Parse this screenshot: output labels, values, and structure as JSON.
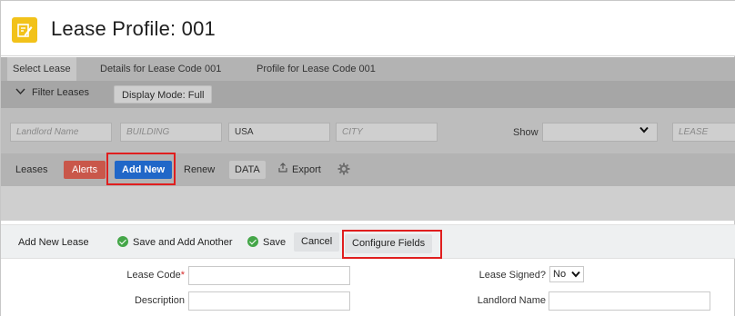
{
  "header": {
    "title": "Lease Profile: 001"
  },
  "tabs": [
    {
      "label": "Select Lease"
    },
    {
      "label": "Details for Lease Code 001"
    },
    {
      "label": "Profile for Lease Code 001"
    }
  ],
  "filter": {
    "toggle_label": "Filter Leases",
    "display_mode_label": "Display Mode: Full",
    "fields": {
      "landlord_placeholder": "Landlord Name",
      "building_placeholder": "BUILDING",
      "country_value": "USA",
      "city_placeholder": "CITY",
      "show_label": "Show",
      "show_value": "",
      "lease_placeholder": "LEASE"
    }
  },
  "actionbar": {
    "leases_label": "Leases",
    "alerts": "Alerts",
    "add_new": "Add New",
    "renew": "Renew",
    "data": "DATA",
    "export": "Export"
  },
  "add_new_lease": {
    "title": "Add New Lease",
    "save_and_add_another": "Save and Add Another",
    "save": "Save",
    "cancel": "Cancel",
    "configure_fields": "Configure Fields"
  },
  "form": {
    "lease_code_label": "Lease Code",
    "lease_code_required": "*",
    "description_label": "Description",
    "lease_signed_label": "Lease Signed?",
    "lease_signed_value": "No",
    "landlord_name_label": "Landlord Name"
  },
  "colors": {
    "accent_blue": "#2067c8",
    "alerts_red": "#c9574a",
    "highlight_red": "#e01e1e",
    "app_icon_yellow": "#f2c21a",
    "save_green": "#44a648"
  }
}
